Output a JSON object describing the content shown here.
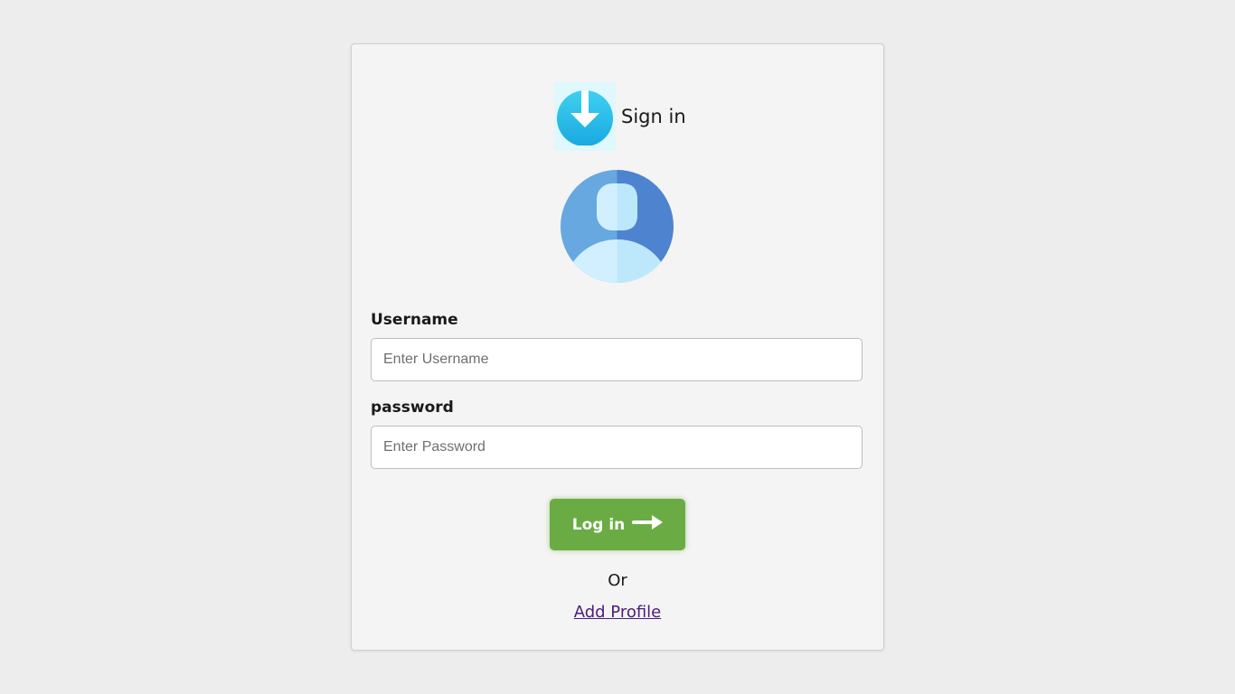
{
  "header": {
    "title": "Sign in",
    "icon": "download-arrow-icon"
  },
  "avatar": {
    "icon": "user-avatar-icon"
  },
  "form": {
    "username_label": "Username",
    "username_placeholder": "Enter Username",
    "username_value": "",
    "password_label": "password",
    "password_placeholder": "Enter Password",
    "password_value": ""
  },
  "actions": {
    "login_label": "Log in",
    "login_icon": "arrow-right-icon",
    "or_text": "Or",
    "add_profile_label": "Add Profile"
  },
  "colors": {
    "page_bg": "#ededed",
    "card_bg": "#f4f4f4",
    "button_green": "#6aac43",
    "link_purple": "#4b1d7a",
    "icon_blue": "#25b9e6"
  }
}
